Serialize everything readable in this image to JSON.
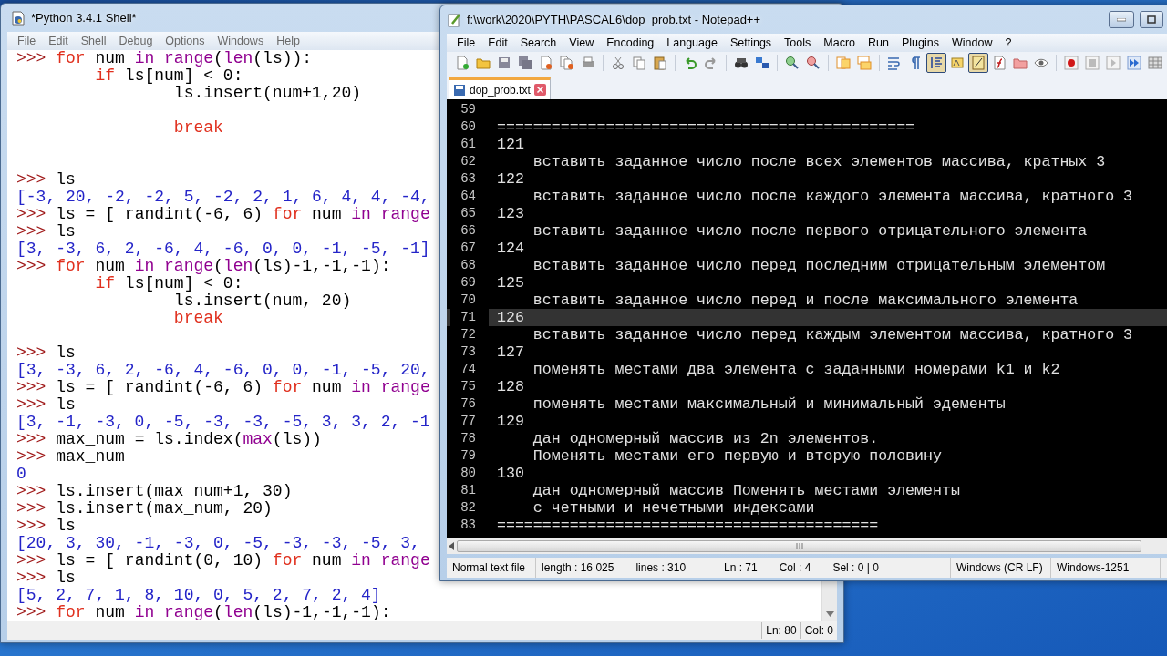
{
  "idle": {
    "title": "*Python 3.4.1 Shell*",
    "menu": [
      "File",
      "Edit",
      "Shell",
      "Debug",
      "Options",
      "Windows",
      "Help"
    ],
    "lines": [
      {
        "kind": "code",
        "tokens": [
          {
            "kind": "prompt",
            "text": ">>> "
          },
          {
            "kind": "keyword",
            "text": "for"
          },
          {
            "kind": "plain",
            "text": " num "
          },
          {
            "kind": "builtin",
            "text": "in range"
          },
          {
            "kind": "plain",
            "text": "("
          },
          {
            "kind": "builtin",
            "text": "len"
          },
          {
            "kind": "plain",
            "text": "(ls)):"
          }
        ]
      },
      {
        "kind": "code",
        "tokens": [
          {
            "kind": "keyword",
            "text": "        if"
          },
          {
            "kind": "plain",
            "text": " ls[num] < 0:"
          }
        ]
      },
      {
        "kind": "code",
        "tokens": [
          {
            "kind": "plain",
            "text": "                ls.insert(num+1,20)"
          }
        ]
      },
      {
        "kind": "blank"
      },
      {
        "kind": "code",
        "tokens": [
          {
            "kind": "keyword",
            "text": "                break"
          }
        ]
      },
      {
        "kind": "blank"
      },
      {
        "kind": "blank"
      },
      {
        "kind": "code",
        "tokens": [
          {
            "kind": "prompt",
            "text": ">>> "
          },
          {
            "kind": "plain",
            "text": "ls"
          }
        ]
      },
      {
        "kind": "code",
        "tokens": [
          {
            "kind": "output",
            "text": "[-3, 20, -2, -2, 5, -2, 2, 1, 6, 4, 4, -4,"
          }
        ]
      },
      {
        "kind": "code",
        "tokens": [
          {
            "kind": "prompt",
            "text": ">>> "
          },
          {
            "kind": "plain",
            "text": "ls = [ randint(-6, 6) "
          },
          {
            "kind": "keyword",
            "text": "for"
          },
          {
            "kind": "plain",
            "text": " num "
          },
          {
            "kind": "builtin",
            "text": "in range"
          }
        ]
      },
      {
        "kind": "code",
        "tokens": [
          {
            "kind": "prompt",
            "text": ">>> "
          },
          {
            "kind": "plain",
            "text": "ls"
          }
        ]
      },
      {
        "kind": "code",
        "tokens": [
          {
            "kind": "output",
            "text": "[3, -3, 6, 2, -6, 4, -6, 0, 0, -1, -5, -1]"
          }
        ]
      },
      {
        "kind": "code",
        "tokens": [
          {
            "kind": "prompt",
            "text": ">>> "
          },
          {
            "kind": "keyword",
            "text": "for"
          },
          {
            "kind": "plain",
            "text": " num "
          },
          {
            "kind": "builtin",
            "text": "in range"
          },
          {
            "kind": "plain",
            "text": "("
          },
          {
            "kind": "builtin",
            "text": "len"
          },
          {
            "kind": "plain",
            "text": "(ls)-1,-1,-1):"
          }
        ]
      },
      {
        "kind": "code",
        "tokens": [
          {
            "kind": "keyword",
            "text": "        if"
          },
          {
            "kind": "plain",
            "text": " ls[num] < 0:"
          }
        ]
      },
      {
        "kind": "code",
        "tokens": [
          {
            "kind": "plain",
            "text": "                ls.insert(num, 20)"
          }
        ]
      },
      {
        "kind": "code",
        "tokens": [
          {
            "kind": "keyword",
            "text": "                break"
          }
        ]
      },
      {
        "kind": "blank"
      },
      {
        "kind": "code",
        "tokens": [
          {
            "kind": "prompt",
            "text": ">>> "
          },
          {
            "kind": "plain",
            "text": "ls"
          }
        ]
      },
      {
        "kind": "code",
        "tokens": [
          {
            "kind": "output",
            "text": "[3, -3, 6, 2, -6, 4, -6, 0, 0, -1, -5, 20,"
          }
        ]
      },
      {
        "kind": "code",
        "tokens": [
          {
            "kind": "prompt",
            "text": ">>> "
          },
          {
            "kind": "plain",
            "text": "ls = [ randint(-6, 6) "
          },
          {
            "kind": "keyword",
            "text": "for"
          },
          {
            "kind": "plain",
            "text": " num "
          },
          {
            "kind": "builtin",
            "text": "in range"
          }
        ]
      },
      {
        "kind": "code",
        "tokens": [
          {
            "kind": "prompt",
            "text": ">>> "
          },
          {
            "kind": "plain",
            "text": "ls"
          }
        ]
      },
      {
        "kind": "code",
        "tokens": [
          {
            "kind": "output",
            "text": "[3, -1, -3, 0, -5, -3, -3, -5, 3, 3, 2, -1"
          }
        ]
      },
      {
        "kind": "code",
        "tokens": [
          {
            "kind": "prompt",
            "text": ">>> "
          },
          {
            "kind": "plain",
            "text": "max_num = ls.index("
          },
          {
            "kind": "builtin",
            "text": "max"
          },
          {
            "kind": "plain",
            "text": "(ls))"
          }
        ]
      },
      {
        "kind": "code",
        "tokens": [
          {
            "kind": "prompt",
            "text": ">>> "
          },
          {
            "kind": "plain",
            "text": "max_num"
          }
        ]
      },
      {
        "kind": "code",
        "tokens": [
          {
            "kind": "output",
            "text": "0"
          }
        ]
      },
      {
        "kind": "code",
        "tokens": [
          {
            "kind": "prompt",
            "text": ">>> "
          },
          {
            "kind": "plain",
            "text": "ls.insert(max_num+1, 30)"
          }
        ]
      },
      {
        "kind": "code",
        "tokens": [
          {
            "kind": "prompt",
            "text": ">>> "
          },
          {
            "kind": "plain",
            "text": "ls.insert(max_num, 20)"
          }
        ]
      },
      {
        "kind": "code",
        "tokens": [
          {
            "kind": "prompt",
            "text": ">>> "
          },
          {
            "kind": "plain",
            "text": "ls"
          }
        ]
      },
      {
        "kind": "code",
        "tokens": [
          {
            "kind": "output",
            "text": "[20, 3, 30, -1, -3, 0, -5, -3, -3, -5, 3,"
          }
        ]
      },
      {
        "kind": "code",
        "tokens": [
          {
            "kind": "prompt",
            "text": ">>> "
          },
          {
            "kind": "plain",
            "text": "ls = [ randint(0, 10) "
          },
          {
            "kind": "keyword",
            "text": "for"
          },
          {
            "kind": "plain",
            "text": " num "
          },
          {
            "kind": "builtin",
            "text": "in range"
          }
        ]
      },
      {
        "kind": "code",
        "tokens": [
          {
            "kind": "prompt",
            "text": ">>> "
          },
          {
            "kind": "plain",
            "text": "ls"
          }
        ]
      },
      {
        "kind": "code",
        "tokens": [
          {
            "kind": "output",
            "text": "[5, 2, 7, 1, 8, 10, 0, 5, 2, 7, 2, 4]"
          }
        ]
      },
      {
        "kind": "code",
        "tokens": [
          {
            "kind": "prompt",
            "text": ">>> "
          },
          {
            "kind": "keyword",
            "text": "for"
          },
          {
            "kind": "plain",
            "text": " num "
          },
          {
            "kind": "builtin",
            "text": "in range"
          },
          {
            "kind": "plain",
            "text": "("
          },
          {
            "kind": "builtin",
            "text": "len"
          },
          {
            "kind": "plain",
            "text": "(ls)-1,-1,-1):"
          }
        ]
      }
    ],
    "status_bar": [
      "Ln: 80",
      "Col: 0"
    ]
  },
  "notepad": {
    "title": "f:\\work\\2020\\PYTH\\PASCAL6\\dop_prob.txt - Notepad++",
    "menu": [
      "File",
      "Edit",
      "Search",
      "View",
      "Encoding",
      "Language",
      "Settings",
      "Tools",
      "Macro",
      "Run",
      "Plugins",
      "Window",
      "?"
    ],
    "toolbar": [
      {
        "kind": "new",
        "on": false
      },
      {
        "kind": "open",
        "on": false
      },
      {
        "kind": "save",
        "on": false
      },
      {
        "kind": "save-all",
        "on": false
      },
      {
        "kind": "close",
        "on": false
      },
      {
        "kind": "close-all",
        "on": false
      },
      {
        "kind": "print",
        "on": false
      },
      {
        "kind": "separator"
      },
      {
        "kind": "cut",
        "on": false
      },
      {
        "kind": "copy",
        "on": false
      },
      {
        "kind": "paste",
        "on": false
      },
      {
        "kind": "separator"
      },
      {
        "kind": "undo",
        "on": false
      },
      {
        "kind": "redo",
        "on": false
      },
      {
        "kind": "separator"
      },
      {
        "kind": "find",
        "on": false
      },
      {
        "kind": "replace",
        "on": false
      },
      {
        "kind": "separator"
      },
      {
        "kind": "zoom-in",
        "on": false
      },
      {
        "kind": "zoom-out",
        "on": false
      },
      {
        "kind": "separator"
      },
      {
        "kind": "sync-vertical",
        "on": false
      },
      {
        "kind": "sync-horizontal",
        "on": false
      },
      {
        "kind": "separator"
      },
      {
        "kind": "word-wrap",
        "on": false
      },
      {
        "kind": "all-chars",
        "on": false
      },
      {
        "kind": "indent-guide",
        "on": true
      },
      {
        "kind": "language",
        "on": false
      },
      {
        "kind": "document-map",
        "on": true
      },
      {
        "kind": "function-list",
        "on": false
      },
      {
        "kind": "folder",
        "on": false
      },
      {
        "kind": "eye",
        "on": false
      },
      {
        "kind": "separator"
      },
      {
        "kind": "record",
        "on": false
      },
      {
        "kind": "stop",
        "on": false
      },
      {
        "kind": "play",
        "on": false
      },
      {
        "kind": "play-repeat",
        "on": false
      },
      {
        "kind": "save-macro",
        "on": false
      }
    ],
    "tabs": [
      {
        "label": "dop_prob.txt",
        "selected": true
      }
    ],
    "lines": [
      {
        "number": "59",
        "current": false
      },
      {
        "number": "60",
        "text": "==============================================",
        "current": false
      },
      {
        "number": "61",
        "text": "121",
        "current": false
      },
      {
        "number": "62",
        "text": "    вставить заданное число после всех элементов массива, кратных 3",
        "current": false
      },
      {
        "number": "63",
        "text": "122",
        "current": false
      },
      {
        "number": "64",
        "text": "    вставить заданное число после каждого элемента массива, кратного 3",
        "current": false
      },
      {
        "number": "65",
        "text": "123",
        "current": false
      },
      {
        "number": "66",
        "text": "    вставить заданное число после первого отрицательного элемента",
        "current": false
      },
      {
        "number": "67",
        "text": "124",
        "current": false
      },
      {
        "number": "68",
        "text": "    вставить заданное число перед последним отрицательным элементом",
        "current": false
      },
      {
        "number": "69",
        "text": "125",
        "current": false
      },
      {
        "number": "70",
        "text": "    вставить заданное число перед и после максимального элемента",
        "current": false
      },
      {
        "number": "71",
        "text": "126",
        "current": true
      },
      {
        "number": "72",
        "text": "    вставить заданное число перед каждым элементом массива, кратного 3",
        "current": false
      },
      {
        "number": "73",
        "text": "127",
        "current": false
      },
      {
        "number": "74",
        "text": "    поменять местами два элемента с заданными номерами k1 и k2",
        "current": false
      },
      {
        "number": "75",
        "text": "128",
        "current": false
      },
      {
        "number": "76",
        "text": "    поменять местами максимальный и минимальный эдементы",
        "current": false
      },
      {
        "number": "77",
        "text": "129",
        "current": false
      },
      {
        "number": "78",
        "text": "    дан одномерный массив из 2n элементов.",
        "current": false
      },
      {
        "number": "79",
        "text": "    Поменять местами его первую и вторую половину",
        "current": false
      },
      {
        "number": "80",
        "text": "130",
        "current": false
      },
      {
        "number": "81",
        "text": "    дан одномерный массив Поменять местами элементы",
        "current": false
      },
      {
        "number": "82",
        "text": "    с четными и нечетными индексами",
        "current": false
      },
      {
        "number": "83",
        "text": "==========================================",
        "current": false
      }
    ],
    "status_bar": [
      "Normal text file",
      "length : 16 025",
      "lines : 310",
      "Ln : 71",
      "Col : 4",
      "Sel : 0 | 0",
      "Windows (CR LF)",
      "Windows-1251"
    ]
  }
}
